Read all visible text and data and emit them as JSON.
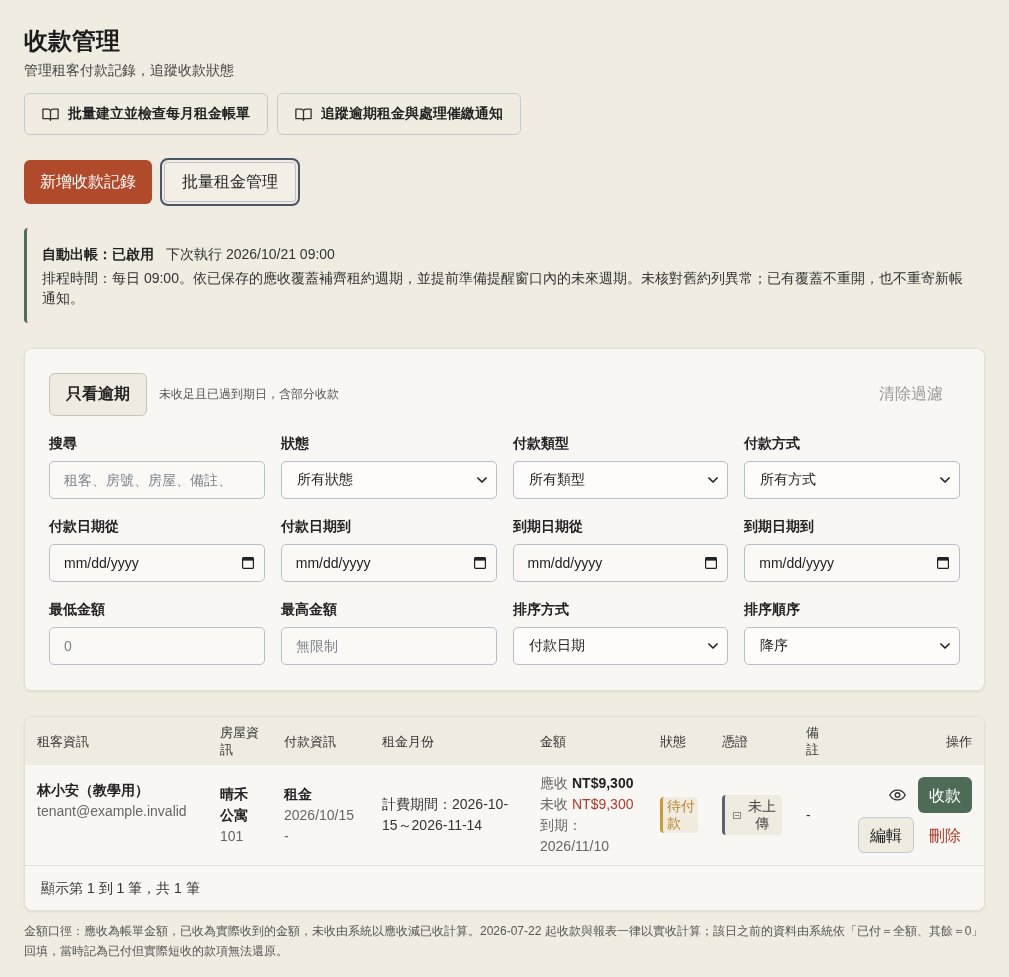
{
  "header": {
    "title": "收款管理",
    "subtitle": "管理租客付款記錄，追蹤收款狀態"
  },
  "guide_links": [
    {
      "label": "批量建立並檢查每月租金帳單"
    },
    {
      "label": "追蹤逾期租金與處理催繳通知"
    }
  ],
  "actions": [
    {
      "label": "新增收款記錄",
      "kind": "primary",
      "focused": false
    },
    {
      "label": "批量租金管理",
      "kind": "secondary",
      "focused": true
    }
  ],
  "notice": {
    "title": "自動出帳：已啟用",
    "next_run": "下次執行 2026/10/21 09:00",
    "detail": "排程時間：每日 09:00。依已保存的應收覆蓋補齊租約週期，並提前準備提醒窗口內的未來週期。未核對舊約列異常；已有覆蓋不重開，也不重寄新帳通知。"
  },
  "filters": {
    "overdue_toggle": {
      "label": "只看逾期",
      "on": false
    },
    "overdue_hint": "未收足且已過到期日，含部分收款",
    "clear_label": "清除過濾",
    "fields": [
      {
        "label": "搜尋",
        "kind": "search",
        "placeholder": "租客、房號、房屋、備註、"
      },
      {
        "label": "狀態",
        "kind": "select",
        "value": "所有狀態"
      },
      {
        "label": "付款類型",
        "kind": "select",
        "value": "所有類型"
      },
      {
        "label": "付款方式",
        "kind": "select",
        "value": "所有方式"
      },
      {
        "label": "付款日期從",
        "kind": "date",
        "placeholder": "mm/dd/yyyy"
      },
      {
        "label": "付款日期到",
        "kind": "date",
        "placeholder": "mm/dd/yyyy"
      },
      {
        "label": "到期日期從",
        "kind": "date",
        "placeholder": "mm/dd/yyyy"
      },
      {
        "label": "到期日期到",
        "kind": "date",
        "placeholder": "mm/dd/yyyy"
      },
      {
        "label": "最低金額",
        "kind": "number",
        "placeholder": "0"
      },
      {
        "label": "最高金額",
        "kind": "number",
        "placeholder": "無限制"
      },
      {
        "label": "排序方式",
        "kind": "select",
        "value": "付款日期"
      },
      {
        "label": "排序順序",
        "kind": "select",
        "value": "降序"
      }
    ]
  },
  "table": {
    "columns": [
      "租客資訊",
      "房屋資訊",
      "付款資訊",
      "租金月份",
      "金額",
      "狀態",
      "憑證",
      "備註",
      "操作"
    ],
    "rows": [
      {
        "tenant_name": "林小安（教學用）",
        "tenant_email": "tenant@example.invalid",
        "property": "晴禾公寓",
        "unit": "101",
        "payment_type": "租金",
        "payment_date": "2026/10/15",
        "payment_method": "-",
        "billing_period": "計費期間：2026-10-15～2026-11-14",
        "receivable_label": "應收",
        "receivable": "NT$9,300",
        "outstanding_label": "未收",
        "outstanding": "NT$9,300",
        "due": "到期：2026/11/10",
        "status": {
          "label": "待付款",
          "kind": "pending"
        },
        "receipt": {
          "label": "未上傳",
          "kind": "missing"
        },
        "note": "-",
        "actions": [
          {
            "kind": "view"
          },
          {
            "kind": "collect",
            "label": "收款"
          },
          {
            "kind": "edit",
            "label": "編輯"
          },
          {
            "kind": "delete",
            "label": "刪除"
          }
        ]
      }
    ],
    "footer": "顯示第 1 到 1 筆，共 1 筆"
  },
  "footnote": "金額口徑：應收為帳單金額，已收為實際收到的金額，未收由系統以應收減已收計算。2026-07-22 起收款與報表一律以實收計算；該日之前的資料由系統依「已付＝全額、其餘＝0」回填，當時記為已付但實際短收的款項無法還原。"
}
